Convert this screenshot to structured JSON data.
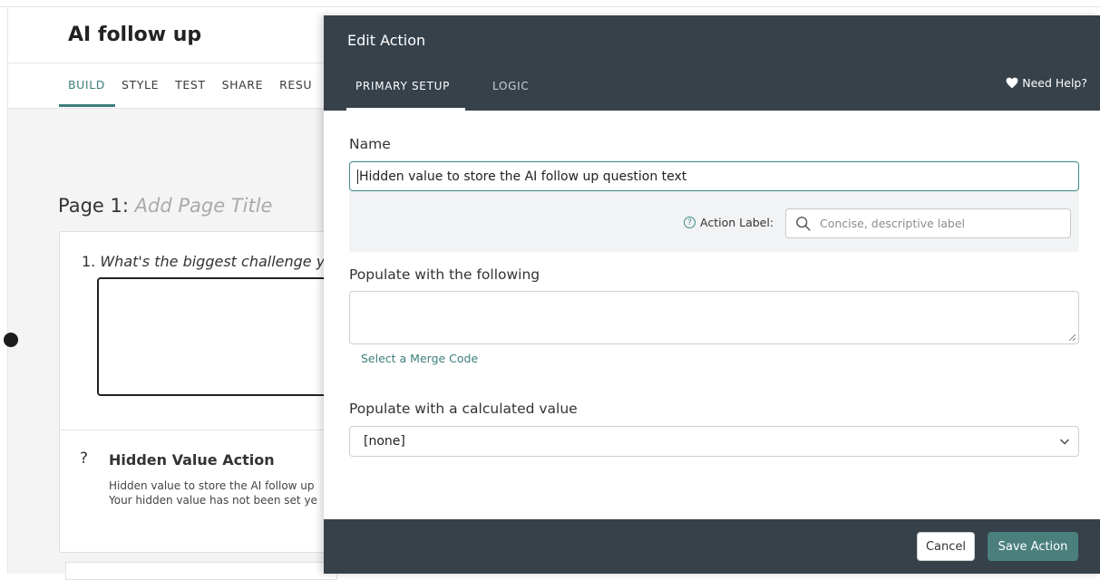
{
  "survey": {
    "title": "AI follow up",
    "tabs": [
      "BUILD",
      "STYLE",
      "TEST",
      "SHARE",
      "RESU"
    ],
    "page_label": "Page 1: ",
    "page_title_placeholder": "Add Page Title",
    "question_number": "1. ",
    "question_text": "What's the biggest challenge y",
    "hidden_value": {
      "icon_glyph": "?",
      "title": "Hidden Value Action",
      "line1": "Hidden value to store the AI follow up",
      "line2": "Your hidden value has not been set ye"
    }
  },
  "panel": {
    "title": "Edit Action",
    "tabs": {
      "primary": "PRIMARY SETUP",
      "logic": "LOGIC"
    },
    "need_help": "Need Help?",
    "name_label": "Name",
    "name_value": "Hidden value to store the AI follow up question text",
    "action_label": {
      "label": "Action Label:",
      "help_glyph": "?",
      "placeholder": "Concise, descriptive label"
    },
    "populate_label": "Populate with the following",
    "merge_code_link": "Select a Merge Code",
    "calculated_label": "Populate with a calculated value",
    "calculated_selected": "[none]",
    "footer": {
      "cancel": "Cancel",
      "save": "Save Action"
    }
  },
  "colors": {
    "accent": "#3d7f7a",
    "panel_dark": "#36414a",
    "save_button": "#4a7f7c"
  },
  "icons": [
    "heart-icon",
    "help-circle-icon",
    "search-icon",
    "resize-handle-icon",
    "chevron-down-icon"
  ]
}
